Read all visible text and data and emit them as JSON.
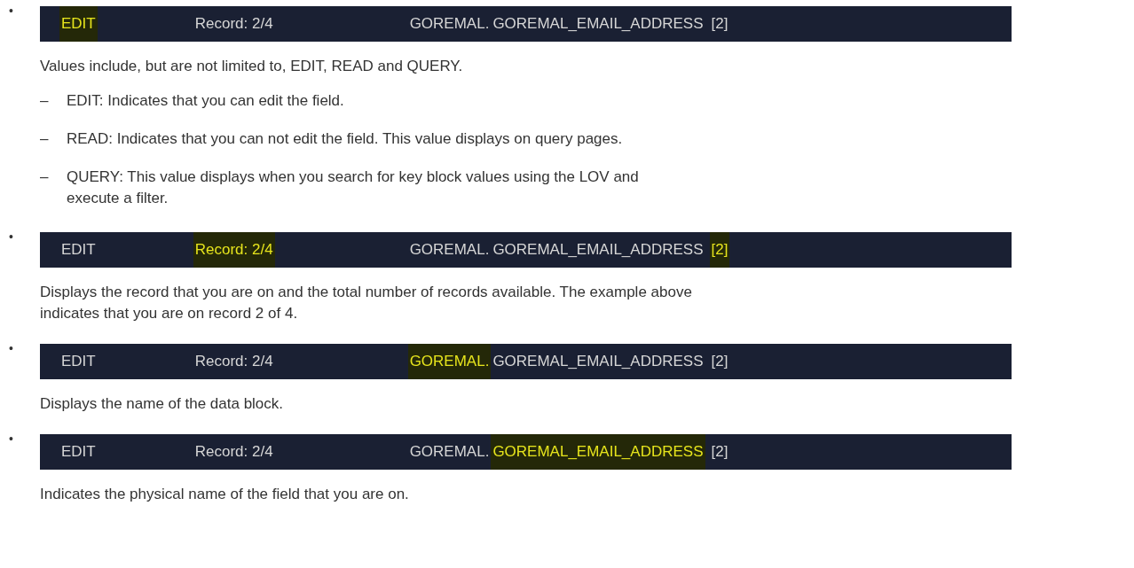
{
  "items": [
    {
      "bullet": "•",
      "status_bar": {
        "segments": [
          {
            "kind": "mode",
            "text": "EDIT",
            "selected": true
          },
          {
            "kind": "record",
            "text": "Record: 2/4",
            "selected": false
          },
          {
            "kind": "block",
            "text": "GOREMAL.",
            "selected": false
          },
          {
            "kind": "field",
            "text": "GOREMAL_EMAIL_ADDRESS",
            "selected": false
          },
          {
            "kind": "index",
            "text": "[2]",
            "selected": false
          }
        ]
      },
      "paragraphs": [
        "Values include, but are not limited to, EDIT, READ and QUERY."
      ],
      "sub_items": [
        {
          "marker": "–",
          "text": "EDIT: Indicates that you can edit the field."
        },
        {
          "marker": "–",
          "text": "READ: Indicates that you can not edit the field. This value displays on query pages."
        },
        {
          "marker": "–",
          "text": "QUERY: This value displays when you search for key block values using the LOV and execute a filter."
        }
      ]
    },
    {
      "bullet": "•",
      "status_bar": {
        "segments": [
          {
            "kind": "mode",
            "text": "EDIT",
            "selected": false
          },
          {
            "kind": "record",
            "text": "Record: 2/4",
            "selected": true
          },
          {
            "kind": "block",
            "text": "GOREMAL.",
            "selected": false
          },
          {
            "kind": "field",
            "text": "GOREMAL_EMAIL_ADDRESS",
            "selected": false
          },
          {
            "kind": "index",
            "text": "[2]",
            "selected": true
          }
        ]
      },
      "paragraphs": [
        "Displays the record that you are on and the total number of records available. The example above indicates that you are on record 2 of 4."
      ]
    },
    {
      "bullet": "•",
      "status_bar": {
        "segments": [
          {
            "kind": "mode",
            "text": "EDIT",
            "selected": false
          },
          {
            "kind": "record",
            "text": "Record: 2/4",
            "selected": false
          },
          {
            "kind": "block",
            "text": "GOREMAL.",
            "selected": true
          },
          {
            "kind": "field",
            "text": "GOREMAL_EMAIL_ADDRESS",
            "selected": false
          },
          {
            "kind": "index",
            "text": "[2]",
            "selected": false
          }
        ]
      },
      "paragraphs": [
        "Displays the name of the data block."
      ]
    },
    {
      "bullet": "•",
      "status_bar": {
        "segments": [
          {
            "kind": "mode",
            "text": "EDIT",
            "selected": false
          },
          {
            "kind": "record",
            "text": "Record: 2/4",
            "selected": false
          },
          {
            "kind": "block",
            "text": "GOREMAL.",
            "selected": false
          },
          {
            "kind": "field",
            "text": "GOREMAL_EMAIL_ADDRESS",
            "selected": true
          },
          {
            "kind": "index",
            "text": "[2]",
            "selected": false
          }
        ]
      },
      "paragraphs": [
        "Indicates the physical name of the field that you are on."
      ]
    }
  ]
}
